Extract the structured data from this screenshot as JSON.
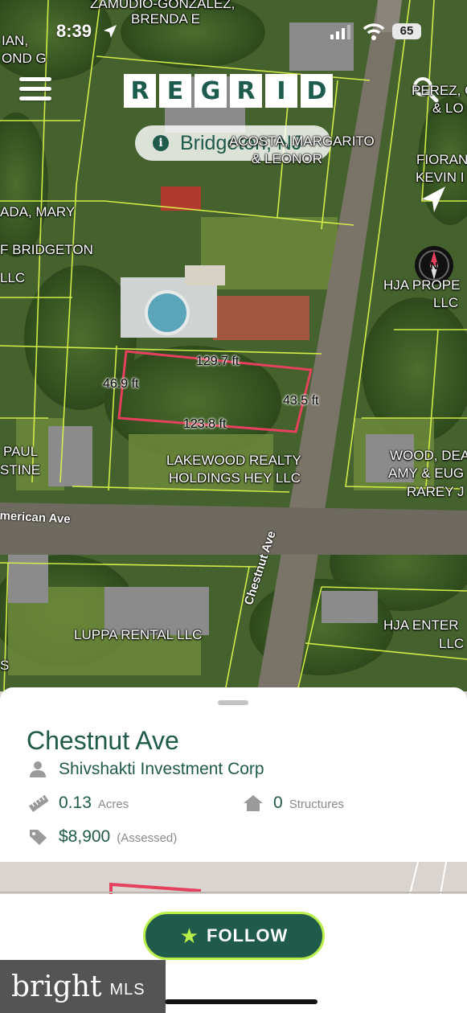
{
  "status_bar": {
    "time": "8:39",
    "battery": "65"
  },
  "header": {
    "logo_letters": [
      "R",
      "E",
      "G",
      "R",
      "I",
      "D"
    ],
    "location": "Bridgeton, NJ"
  },
  "map": {
    "owner_labels": [
      "ZAMUDIO-GONZALEZ,",
      "BRENDA E",
      "IAN,",
      "OND G",
      "PEREZ, G",
      "& LO",
      "ACOSTA, MARGARITO",
      "& LEONOR",
      "FIORAN",
      "KEVIN I",
      "ADA, MARY",
      "F BRIDGETON",
      "LLC",
      "HJA PROPE",
      "LLC",
      "PAUL",
      "STINE",
      "LAKEWOOD REALTY",
      "HOLDINGS HEY LLC",
      "WOOD, DEA",
      "AMY & EUG",
      "RAREY J",
      "LUPPA RENTAL LLC",
      "HJA ENTER",
      "LLC",
      "S"
    ],
    "dimensions": [
      "129.7 ft",
      "46.9 ft",
      "43.5 ft",
      "123.8 ft"
    ],
    "streets": [
      "merican Ave",
      "Chestnut Ave"
    ],
    "parcel_color": "#e5405e",
    "lot_line_color": "#d8f34a"
  },
  "parcel": {
    "title": "Chestnut Ave",
    "owner": "Shivshakti Investment Corp",
    "acres_value": "0.13",
    "acres_label": "Acres",
    "structures_value": "0",
    "structures_label": "Structures",
    "assessed_value": "$8,900",
    "assessed_label": "(Assessed)"
  },
  "actions": {
    "follow_label": "FOLLOW"
  },
  "watermark": {
    "brand": "bright",
    "suffix": "MLS"
  },
  "colors": {
    "brand_green": "#1f5a4a",
    "accent_lime": "#b9ef4b"
  }
}
